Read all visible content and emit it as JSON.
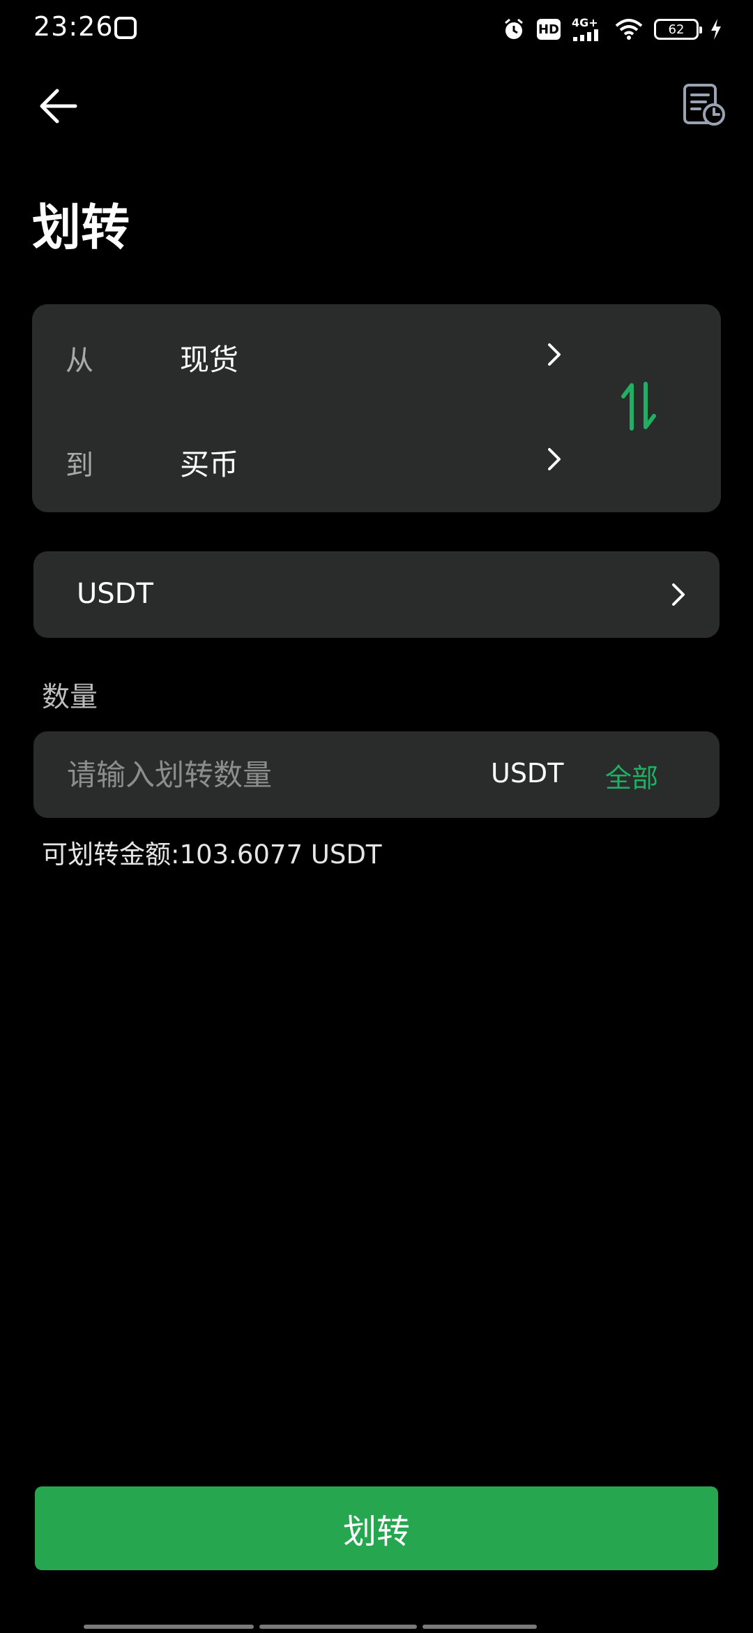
{
  "status_bar": {
    "time": "23:26",
    "network": "4G+",
    "hd": "HD",
    "battery": "62"
  },
  "header": {
    "title": "划转"
  },
  "transfer": {
    "from_label": "从",
    "from_value": "现货",
    "to_label": "到",
    "to_value": "买币"
  },
  "coin": {
    "selected": "USDT"
  },
  "quantity": {
    "heading": "数量",
    "placeholder": "请输入划转数量",
    "unit": "USDT",
    "all_label": "全部"
  },
  "available": {
    "text": "可划转金额:103.6077 USDT"
  },
  "submit": {
    "label": "划转"
  },
  "colors": {
    "accent_green": "#26a74f",
    "link_green": "#1fb063",
    "card_bg": "#2a2b2b"
  }
}
